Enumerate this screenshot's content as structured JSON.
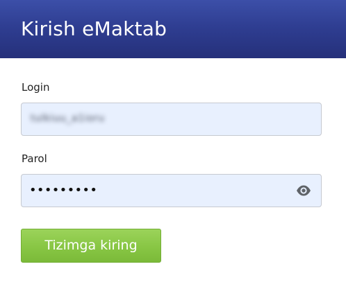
{
  "header": {
    "title": "Kirish eMaktab"
  },
  "form": {
    "login_label": "Login",
    "login_value": "tulkiuu_a1ioru",
    "password_label": "Parol",
    "password_masked": "•••••••••",
    "password_toggle_icon": "eye-icon",
    "submit_label": "Tizimga kiring"
  },
  "colors": {
    "header_bg": "#2f3e92",
    "input_bg": "#e8f0fe",
    "button_bg": "#88c644"
  }
}
